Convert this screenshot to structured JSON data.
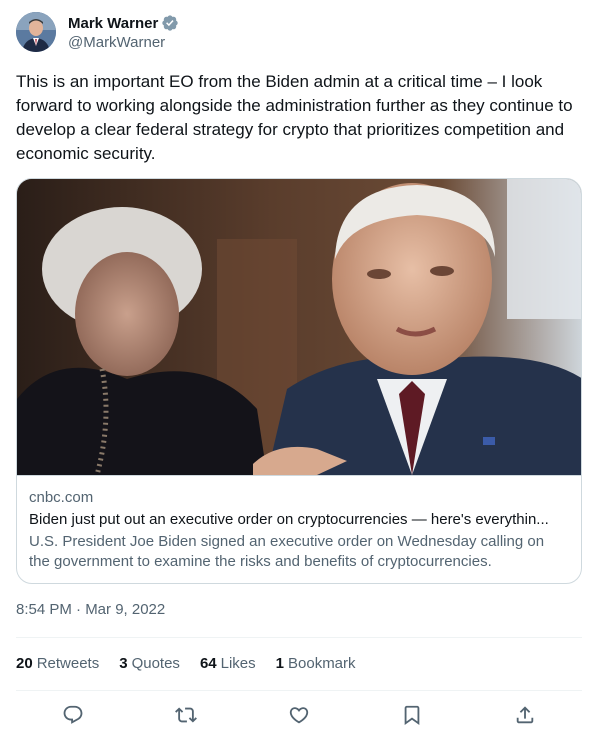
{
  "author": {
    "display_name": "Mark Warner",
    "handle": "@MarkWarner",
    "verified": true,
    "avatar": "avatar-photo"
  },
  "tweet": {
    "text": "This is an important EO from the Biden admin at a critical time – I look forward to working alongside the administration further as they continue to develop a clear federal strategy for crypto that prioritizes competition and economic security."
  },
  "card": {
    "image": "news-photo",
    "domain": "cnbc.com",
    "title": "Biden just put out an executive order on cryptocurrencies — here's everythin...",
    "description": "U.S. President Joe Biden signed an executive order on Wednesday calling on the government to examine the risks and benefits of cryptocurrencies."
  },
  "timestamp": "8:54 PM · Mar 9, 2022",
  "stats": {
    "retweets": {
      "count": "20",
      "label": "Retweets"
    },
    "quotes": {
      "count": "3",
      "label": "Quotes"
    },
    "likes": {
      "count": "64",
      "label": "Likes"
    },
    "bookmarks": {
      "count": "1",
      "label": "Bookmark"
    }
  },
  "actions": [
    "reply-icon",
    "retweet-icon",
    "like-icon",
    "bookmark-icon",
    "share-icon"
  ],
  "colors": {
    "verified_blue": "#829aab",
    "text_primary": "#0f1419",
    "text_secondary": "#536471",
    "border": "#cfd9de",
    "divider": "#eff3f4"
  }
}
